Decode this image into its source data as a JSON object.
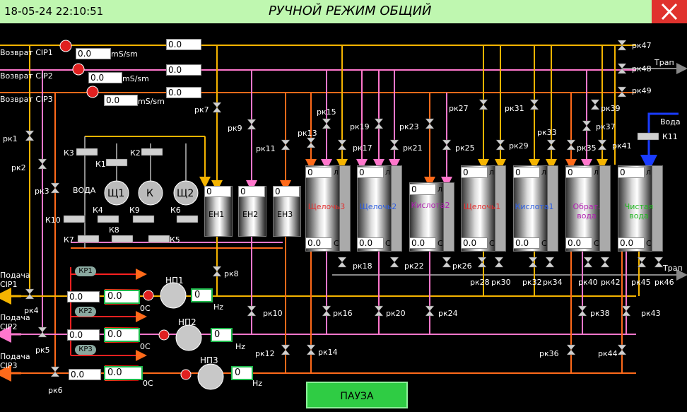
{
  "header": {
    "datetime": "18-05-24 22:10:51",
    "title": "РУЧНОЙ РЕЖИМ ОБЩИЙ"
  },
  "returns": [
    {
      "label": "Возврат CIP1",
      "cond": "0.0",
      "unit": "mS/sm",
      "value": "0.0"
    },
    {
      "label": "Возврат CIP2",
      "cond": "0.0",
      "unit": "mS/sm",
      "value": "0.0"
    },
    {
      "label": "Возврат CIP3",
      "cond": "0.0",
      "unit": "mS/sm",
      "value": "0.0"
    }
  ],
  "supplies": [
    {
      "label1": "Подача",
      "label2": "CIP1",
      "valve": "рк4",
      "flow": "0.0",
      "temp": "0.0",
      "temp_unit": "0С",
      "pump": "НП1",
      "freq": "0",
      "freq_unit": "Hz",
      "kr": "КР1"
    },
    {
      "label1": "Подача",
      "label2": "CIP2",
      "valve": "рк5",
      "flow": "0.0",
      "temp": "0.0",
      "temp_unit": "0С",
      "pump": "НП2",
      "freq": "0",
      "freq_unit": "Hz",
      "kr": "КР2"
    },
    {
      "label1": "Подача",
      "label2": "CIP3",
      "valve": "рк6",
      "flow": "0.0",
      "temp": "0.0",
      "temp_unit": "0С",
      "pump": "НП3",
      "freq": "0",
      "freq_unit": "Hz",
      "kr": "КР3"
    }
  ],
  "dosing": {
    "water": "ВОДА",
    "tanks": [
      "Щ1",
      "К",
      "Щ2"
    ],
    "valves": [
      "К3",
      "К2",
      "К1",
      "К4",
      "К9",
      "К6",
      "К10",
      "К8",
      "К7",
      "К5"
    ]
  },
  "small_tanks": [
    {
      "name": "ЕН1",
      "level": "0"
    },
    {
      "name": "ЕН2",
      "level": "0"
    },
    {
      "name": "ЕН3",
      "level": "0"
    }
  ],
  "tanks": [
    {
      "name": "Щелочь3",
      "color": "#e23030",
      "level": "0",
      "level_unit": "л",
      "temp": "0.0",
      "temp_unit": "С"
    },
    {
      "name": "Щелочь2",
      "color": "#3060e0",
      "level": "0",
      "level_unit": "л",
      "temp": "0.0",
      "temp_unit": "С"
    },
    {
      "name": "Кислота2",
      "color": "#b020b0",
      "level": "0",
      "level_unit": "л",
      "temp": "0.0",
      "temp_unit": "С"
    },
    {
      "name": "Щелочь1",
      "color": "#e23030",
      "level": "0",
      "level_unit": "л",
      "temp": "0.0",
      "temp_unit": "С"
    },
    {
      "name": "Кислота1",
      "color": "#3060e0",
      "level": "0",
      "level_unit": "л",
      "temp": "0.0",
      "temp_unit": "С"
    },
    {
      "name": "Обрат. вода",
      "color": "#b020b0",
      "level": "0",
      "level_unit": "л",
      "temp": "0.0",
      "temp_unit": "С"
    },
    {
      "name": "Чистая вода",
      "color": "#22b822",
      "level": "0",
      "level_unit": "л",
      "temp": "0.0",
      "temp_unit": "С"
    }
  ],
  "valve_labels": {
    "rk1": "рк1",
    "rk2": "рк2",
    "rk3": "рк3",
    "rk7": "рк7",
    "rk8": "рк8",
    "rk9": "рк9",
    "rk10": "рк10",
    "rk11": "рк11",
    "rk12": "рк12",
    "rk13": "рк13",
    "rk14": "рк14",
    "rk15": "рк15",
    "rk16": "рк16",
    "rk17": "рк17",
    "rk18": "рк18",
    "rk19": "рк19",
    "rk20": "рк20",
    "rk21": "рк21",
    "rk22": "рк22",
    "rk23": "рк23",
    "rk24": "рк24",
    "rk25": "рк25",
    "rk26": "рк26",
    "rk27": "рк27",
    "rk28": "рк28",
    "rk29": "рк29",
    "rk30": "рк30",
    "rk31": "рк31",
    "rk32": "рк32",
    "rk33": "рк33",
    "rk34": "рк34",
    "rk35": "рк35",
    "rk36": "рк36",
    "rk37": "рк37",
    "rk38": "рк38",
    "rk39": "рк39",
    "rk40": "рк40",
    "rk41": "рк41",
    "rk42": "рк42",
    "rk43": "рк43",
    "rk44": "рк44",
    "rk45": "рк45",
    "rk46": "рк46",
    "rk47": "рк47",
    "rk48": "рк48",
    "rk49": "рк49",
    "k11": "К11"
  },
  "drain_top": "Трап",
  "drain_bottom": "Трап",
  "water_in": "Вода",
  "pause_label": "ПАУЗА",
  "colors": {
    "line1": "#f5b400",
    "line2": "#ff77cc",
    "line3": "#ff6a1a",
    "water": "#1a3cff",
    "drain": "#888888"
  }
}
